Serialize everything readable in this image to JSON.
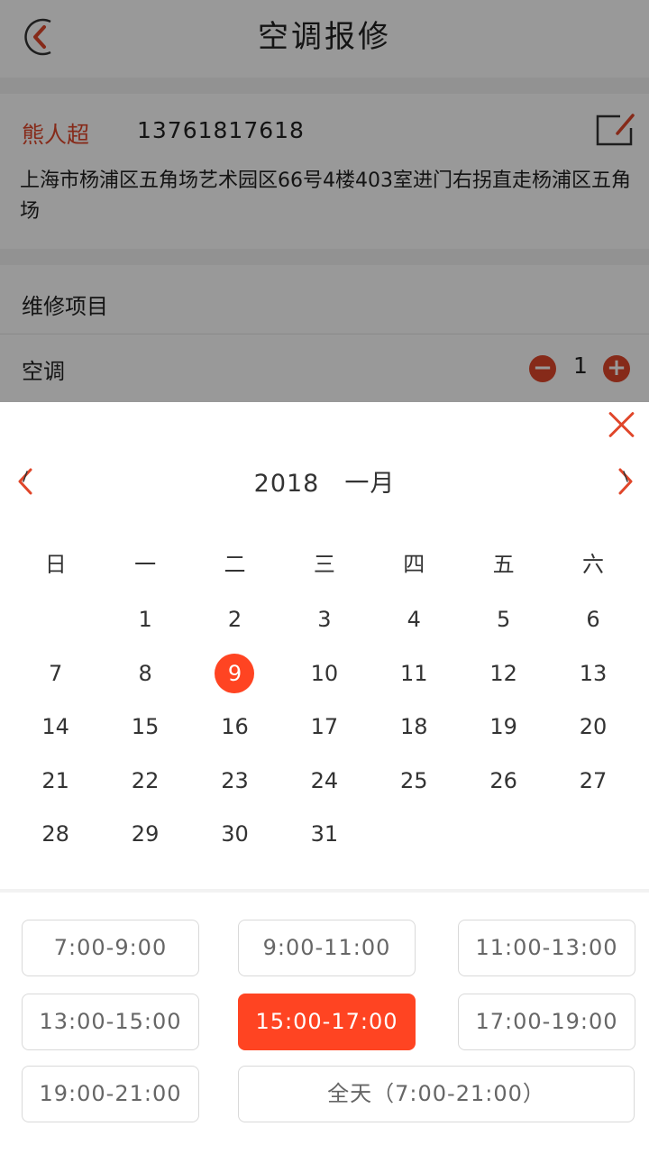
{
  "header": {
    "title": "空调报修",
    "back_icon": "back-arrow-icon"
  },
  "contact": {
    "name": "熊人超",
    "phone": "13761817618",
    "address": "上海市杨浦区五角场艺术园区66号4楼403室进门右拐直走杨浦区五角场",
    "edit_icon": "edit-icon"
  },
  "repair": {
    "section_title": "维修项目",
    "item_name": "空调",
    "quantity": "1",
    "minus_label": "−",
    "plus_label": "+"
  },
  "calendar": {
    "year": "2018",
    "month": "一月",
    "weekdays": [
      "日",
      "一",
      "二",
      "三",
      "四",
      "五",
      "六"
    ],
    "weeks": [
      [
        "",
        "1",
        "2",
        "3",
        "4",
        "5",
        "6"
      ],
      [
        "7",
        "8",
        "9",
        "10",
        "11",
        "12",
        "13"
      ],
      [
        "14",
        "15",
        "16",
        "17",
        "18",
        "19",
        "20"
      ],
      [
        "21",
        "22",
        "23",
        "24",
        "25",
        "26",
        "27"
      ],
      [
        "28",
        "29",
        "30",
        "31",
        "",
        "",
        ""
      ]
    ],
    "selected_day": "9",
    "accent_color": "#ff4422"
  },
  "time_slots": {
    "s1": "7:00-9:00",
    "s2": "9:00-11:00",
    "s3": "11:00-13:00",
    "s4": "13:00-15:00",
    "s5": "15:00-17:00",
    "s6": "17:00-19:00",
    "s7": "19:00-21:00",
    "s8": "全天（7:00-21:00）",
    "selected": "15:00-17:00"
  },
  "colors": {
    "brand": "#e0462a",
    "selected": "#ff4422"
  }
}
